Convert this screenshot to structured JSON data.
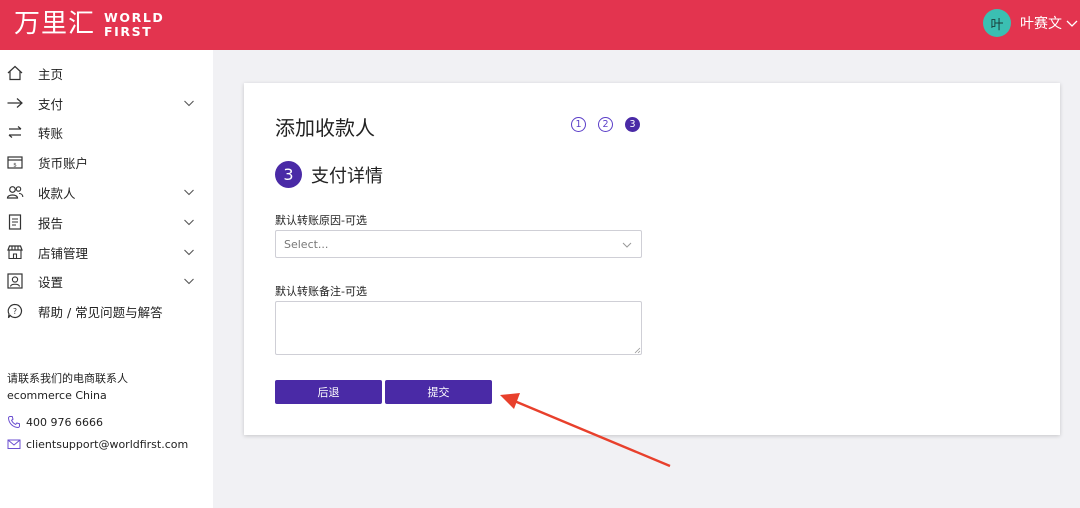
{
  "header": {
    "brand_cn": "万里汇",
    "brand_en_line1": "WORLD",
    "brand_en_line2": "FIRST",
    "avatar_initial": "叶",
    "user_name": "叶赛文"
  },
  "sidebar": {
    "items": [
      {
        "label": "主页",
        "icon": "home-icon",
        "has_chevron": false
      },
      {
        "label": "支付",
        "icon": "arrow-right-icon",
        "has_chevron": true
      },
      {
        "label": "转账",
        "icon": "transfer-icon",
        "has_chevron": false
      },
      {
        "label": "货币账户",
        "icon": "wallet-icon",
        "has_chevron": false
      },
      {
        "label": "收款人",
        "icon": "users-icon",
        "has_chevron": true
      },
      {
        "label": "报告",
        "icon": "report-icon",
        "has_chevron": true
      },
      {
        "label": "店铺管理",
        "icon": "store-icon",
        "has_chevron": true
      },
      {
        "label": "设置",
        "icon": "settings-icon",
        "has_chevron": true
      },
      {
        "label": "帮助 / 常见问题与解答",
        "icon": "help-icon",
        "has_chevron": false
      }
    ],
    "contact": {
      "title": "请联系我们的电商联系人",
      "subtitle": "ecommerce China",
      "phone": "400 976 6666",
      "email": "clientsupport@worldfirst.com"
    }
  },
  "main": {
    "title": "添加收款人",
    "steps": [
      "1",
      "2",
      "3"
    ],
    "active_step": 3,
    "section_number": "3",
    "section_title": "支付详情",
    "reason_label": "默认转账原因-可选",
    "reason_placeholder": "Select...",
    "note_label": "默认转账备注-可选",
    "note_value": "",
    "back_button": "后退",
    "submit_button": "提交"
  },
  "colors": {
    "header_bg": "#e3344f",
    "accent": "#4a2aa6",
    "avatar_bg": "#3bbfb2",
    "annotation_arrow": "#e8402c"
  }
}
